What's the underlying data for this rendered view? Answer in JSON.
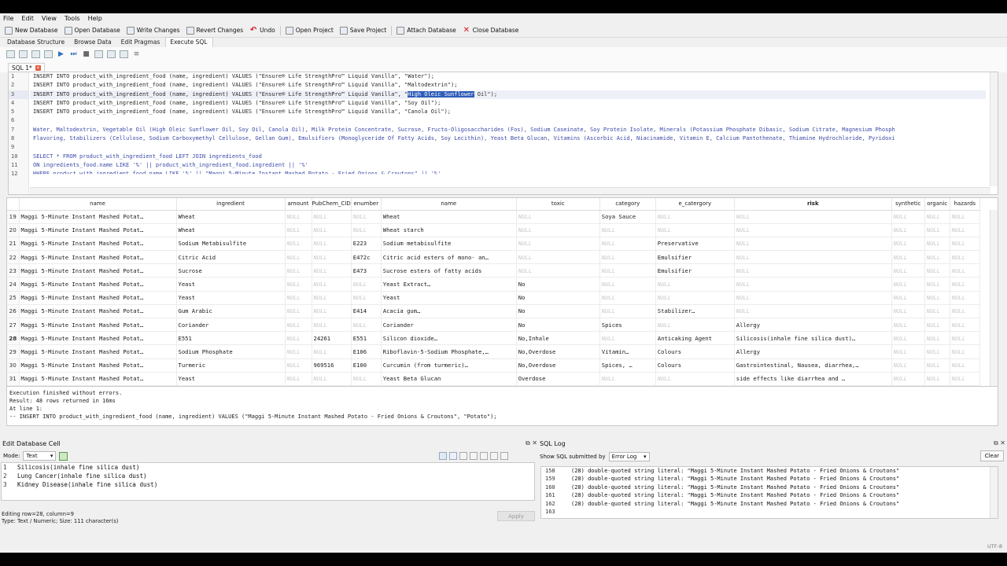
{
  "menu": [
    "File",
    "Edit",
    "View",
    "Tools",
    "Help"
  ],
  "toolbar": [
    {
      "label": "New Database",
      "icon": "new-database-icon"
    },
    {
      "label": "Open Database",
      "icon": "open-database-icon"
    },
    {
      "label": "Write Changes",
      "icon": "write-changes-icon"
    },
    {
      "label": "Revert Changes",
      "icon": "revert-changes-icon"
    },
    {
      "label": "Undo",
      "icon": "undo-icon"
    },
    {
      "label": "Open Project",
      "icon": "open-project-icon"
    },
    {
      "label": "Save Project",
      "icon": "save-project-icon"
    },
    {
      "label": "Attach Database",
      "icon": "attach-database-icon"
    },
    {
      "label": "Close Database",
      "icon": "close-database-icon"
    }
  ],
  "tabs": [
    "Database Structure",
    "Browse Data",
    "Edit Pragmas",
    "Execute SQL"
  ],
  "active_tab": "Execute SQL",
  "sql_tab": "SQL 1*",
  "editor": {
    "line_numbers": [
      "1",
      "2",
      "3",
      "4",
      "5",
      "6",
      "7",
      "8",
      "9",
      "10",
      "11",
      "12"
    ],
    "lines": [
      "INSERT INTO product_with_ingredient_food (name, ingredient) VALUES (\"Ensure® Life StrengthPro™ Liquid Vanilla\", \"Water\");",
      "INSERT INTO product_with_ingredient_food (name, ingredient) VALUES (\"Ensure® Life StrengthPro™ Liquid Vanilla\", \"Maltodextrin\");",
      "INSERT INTO product_with_ingredient_food (name, ingredient) VALUES (\"Ensure® Life StrengthPro™ Liquid Vanilla\", \"",
      "INSERT INTO product_with_ingredient_food (name, ingredient) VALUES (\"Ensure® Life StrengthPro™ Liquid Vanilla\", \"Soy Oil\");",
      "INSERT INTO product_with_ingredient_food (name, ingredient) VALUES (\"Ensure® Life StrengthPro™ Liquid Vanilla\", \"Canola Oil\");",
      "",
      "Water, Maltodextrin, Vegetable Oil (High Oleic Sunflower Oil, Soy Oil, Canola Oil), Milk Protein Concentrate, Sucrose, Fructo-Oligosaccharides (Fos), Sodium Caseinate, Soy Protein Isolate, Minerals (Potassium Phosphate Dibasic, Sodium Citrate, Magnesium Phosph",
      "Flavoring, Stabilizers (Cellulose, Sodium Carboxymethyl Cellulose, Gellan Gum), Emulsifiers (Monoglyceride Of Fatty Acids, Soy Lecithin), Yeast Beta Glucan, Vitamins (Ascorbic Acid, Niacinamide, Vitamin E, Calcium Pantothenate, Thiamine Hydrochloride, Pyridoxi",
      "",
      "SELECT * FROM product_with_ingredient_food LEFT JOIN ingredients_food",
      "ON ingredients_food.name LIKE '%' || product_with_ingredient_food.ingredient || '%'",
      "WHERE product_with_ingredient_food.name LIKE '%' || \"Maggi 5-Minute Instant Mashed Potato - Fried Onions & Croutons\" || '%'"
    ],
    "line3_selected": "High Oleic Sunflower",
    "line3_rest": " Oil\");"
  },
  "grid": {
    "columns": [
      "name",
      "ingredient",
      "amount",
      "PubChem_CID",
      "enumber",
      "name",
      "toxic",
      "category",
      "e_catergory",
      "risk",
      "synthetic",
      "organic",
      "hazards"
    ],
    "null_text": "NULL",
    "rows": [
      {
        "rn": "19",
        "cells": [
          "Maggi 5-Minute Instant Mashed Potat…",
          "Wheat",
          null,
          null,
          null,
          "Wheat",
          null,
          "Soya Sauce",
          null,
          null,
          null,
          null,
          null
        ]
      },
      {
        "rn": "20",
        "cells": [
          "Maggi 5-Minute Instant Mashed Potat…",
          "Wheat",
          null,
          null,
          null,
          "Wheat starch",
          null,
          null,
          null,
          null,
          null,
          null,
          null
        ]
      },
      {
        "rn": "21",
        "cells": [
          "Maggi 5-Minute Instant Mashed Potat…",
          "Sodium Metabisulfite",
          null,
          null,
          "E223",
          "Sodium metabisulfite",
          null,
          null,
          "Preservative",
          null,
          null,
          null,
          null
        ]
      },
      {
        "rn": "22",
        "cells": [
          "Maggi 5-Minute Instant Mashed Potat…",
          "Citric Acid",
          null,
          null,
          "E472c",
          "Citric acid esters of mono- an…",
          null,
          null,
          "Emulsifier",
          null,
          null,
          null,
          null
        ]
      },
      {
        "rn": "23",
        "cells": [
          "Maggi 5-Minute Instant Mashed Potat…",
          "Sucrose",
          null,
          null,
          "E473",
          "Sucrose esters of fatty acids",
          null,
          null,
          "Emulsifier",
          null,
          null,
          null,
          null
        ]
      },
      {
        "rn": "24",
        "cells": [
          "Maggi 5-Minute Instant Mashed Potat…",
          "Yeast",
          null,
          null,
          null,
          "Yeast Extract…",
          "No",
          null,
          null,
          null,
          null,
          null,
          null
        ]
      },
      {
        "rn": "25",
        "cells": [
          "Maggi 5-Minute Instant Mashed Potat…",
          "Yeast",
          null,
          null,
          null,
          "Yeast",
          "No",
          null,
          null,
          null,
          null,
          null,
          null
        ]
      },
      {
        "rn": "26",
        "cells": [
          "Maggi 5-Minute Instant Mashed Potat…",
          "Gum Arabic",
          null,
          null,
          "E414",
          "Acacia gum…",
          "No",
          null,
          "Stabilizer…",
          null,
          null,
          null,
          null
        ]
      },
      {
        "rn": "27",
        "cells": [
          "Maggi 5-Minute Instant Mashed Potat…",
          "Coriander",
          null,
          null,
          null,
          "Coriander",
          "No",
          "Spices",
          null,
          "Allergy",
          null,
          null,
          null
        ]
      },
      {
        "rn": "28",
        "cells": [
          "Maggi 5-Minute Instant Mashed Potat…",
          "E551",
          null,
          "24261",
          "E551",
          "Silicon dioxide…",
          "No,Inhale",
          null,
          "Anticaking Agent",
          "Silicosis(inhale fine silica dust)…",
          null,
          null,
          null
        ]
      },
      {
        "rn": "29",
        "cells": [
          "Maggi 5-Minute Instant Mashed Potat…",
          "Sodium Phosphate",
          null,
          null,
          "E106",
          "Riboflavin-5-Sodium Phosphate,…",
          "No,Overdose",
          "Vitamin…",
          "Colours",
          "Allergy",
          null,
          null,
          null
        ]
      },
      {
        "rn": "30",
        "cells": [
          "Maggi 5-Minute Instant Mashed Potat…",
          "Turmeric",
          null,
          "969516",
          "E100",
          "Curcumin (from turmeric)…",
          "No,Overdose",
          "Spices, …",
          "Colours",
          "Gastrointestinal, Nausea, diarrhea,…",
          null,
          null,
          null
        ]
      },
      {
        "rn": "31",
        "cells": [
          "Maggi 5-Minute Instant Mashed Potat…",
          "Yeast",
          null,
          null,
          null,
          "Yeast Beta Glucan",
          "Overdose",
          null,
          null,
          "side effects like diarrhea and …",
          null,
          null,
          null
        ]
      }
    ]
  },
  "messages": [
    "Execution finished without errors.",
    "Result: 48 rows returned in 16ms",
    "At line 1:",
    "-- INSERT INTO product_with_ingredient_food (name, ingredient) VALUES (\"Maggi 5-Minute Instant Mashed Potato - Fried Onions & Croutons\", \"Potato\");"
  ],
  "edit_cell": {
    "title": "Edit Database Cell",
    "mode_label": "Mode:",
    "mode_value": "Text",
    "lines": [
      {
        "n": "1",
        "text": "Silicosis(inhale fine silica dust)"
      },
      {
        "n": "2",
        "text": "Lung Cancer(inhale fine silica dust)"
      },
      {
        "n": "3",
        "text": "Kidney Disease(inhale fine silica dust)"
      }
    ],
    "status1": "Editing row=28, column=9",
    "status2": "Type: Text / Numeric; Size: 111 character(s)",
    "apply": "Apply"
  },
  "sql_log": {
    "title": "SQL Log",
    "show_label": "Show SQL submitted by",
    "show_value": "Error Log",
    "clear": "Clear",
    "lines": [
      {
        "n": "158",
        "text": "(28) double-quoted string literal: \"Maggi 5-Minute Instant Mashed Potato - Fried Onions & Croutons\""
      },
      {
        "n": "159",
        "text": "(28) double-quoted string literal: \"Maggi 5-Minute Instant Mashed Potato - Fried Onions & Croutons\""
      },
      {
        "n": "160",
        "text": "(28) double-quoted string literal: \"Maggi 5-Minute Instant Mashed Potato - Fried Onions & Croutons\""
      },
      {
        "n": "161",
        "text": "(28) double-quoted string literal: \"Maggi 5-Minute Instant Mashed Potato - Fried Onions & Croutons\""
      },
      {
        "n": "162",
        "text": "(28) double-quoted string literal: \"Maggi 5-Minute Instant Mashed Potato - Fried Onions & Croutons\""
      },
      {
        "n": "163",
        "text": ""
      }
    ]
  },
  "encoding": "UTF-8"
}
